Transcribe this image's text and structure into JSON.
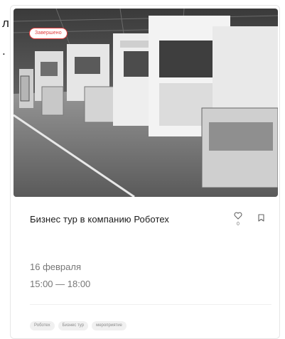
{
  "edge_glyphs": [
    "л",
    "."
  ],
  "event": {
    "status_badge": "Завершено",
    "title": "Бизнес тур в компанию Роботех",
    "likes": "0",
    "date": "16 февраля",
    "time": "15:00 — 18:00",
    "tags": [
      "Роботех",
      "Бизнес тур",
      "мероприятие"
    ],
    "photo_icon": "factory-photo",
    "like_icon": "heart-icon",
    "bookmark_icon": "bookmark-icon"
  },
  "colors": {
    "badge": "#e23a3a",
    "title": "#1b1b1b",
    "secondary_text": "#777777",
    "tag_bg": "#f0f0f0"
  }
}
